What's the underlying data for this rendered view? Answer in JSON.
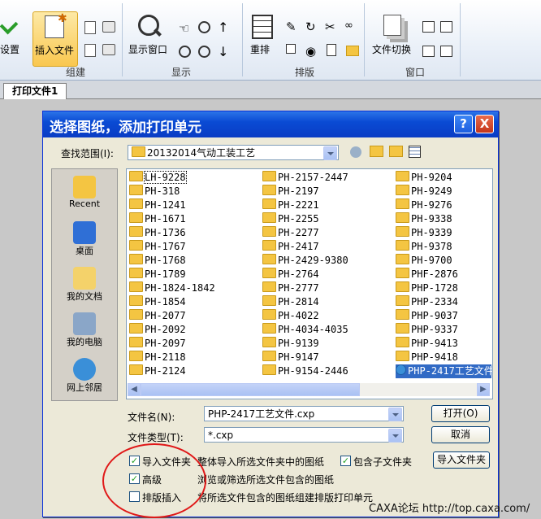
{
  "ribbon": {
    "settings_partial": "设置",
    "insert_file": "插入文件",
    "display_window": "显示窗口",
    "rearrange": "重排",
    "file_switch": "文件切换",
    "groups": [
      "组建",
      "显示",
      "排版",
      "窗口"
    ]
  },
  "doc_tab": "打印文件1",
  "dialog": {
    "title": "选择图纸，添加打印单元",
    "help": "?",
    "close": "X",
    "lookin_label": "查找范围(I):",
    "lookin_value": "20132014气动工装工艺",
    "places": [
      "Recent",
      "桌面",
      "我的文档",
      "我的电脑",
      "网上邻居"
    ],
    "columns": [
      [
        "LH-9228",
        "PH-318",
        "PH-1241",
        "PH-1671",
        "PH-1736",
        "PH-1767",
        "PH-1768",
        "PH-1789",
        "PH-1824-1842",
        "PH-1854",
        "PH-2077",
        "PH-2092",
        "PH-2097",
        "PH-2118",
        "PH-2124"
      ],
      [
        "PH-2157-2447",
        "PH-2197",
        "PH-2221",
        "PH-2255",
        "PH-2277",
        "PH-2417",
        "PH-2429-9380",
        "PH-2764",
        "PH-2777",
        "PH-2814",
        "PH-4022",
        "PH-4034-4035",
        "PH-9139",
        "PH-9147",
        "PH-9154-2446"
      ],
      [
        "PH-9204",
        "PH-9249",
        "PH-9276",
        "PH-9338",
        "PH-9339",
        "PH-9378",
        "PH-9700",
        "PHF-2876",
        "PHP-1728",
        "PHP-2334",
        "PHP-9037",
        "PHP-9337",
        "PHP-9413",
        "PHP-9418",
        "PHP-2417工艺文件"
      ]
    ],
    "filename_label": "文件名(N):",
    "filename_value": "PHP-2417工艺文件.cxp",
    "filetype_label": "文件类型(T):",
    "filetype_value": "*.cxp",
    "open_button": "打开(O)",
    "cancel_button": "取消",
    "import_folder_button": "导入文件夹",
    "opt_import_folder": "导入文件夹",
    "opt_import_desc": "整体导入所选文件夹中的图纸",
    "opt_subfolder": "包含子文件夹",
    "opt_advanced": "高级",
    "opt_advanced_desc": "浏览或筛选所选文件包含的图纸",
    "opt_layout_insert": "排版插入",
    "opt_layout_desc": "将所选文件包含的图纸组建排版打印单元",
    "checks": {
      "import_folder": true,
      "subfolder": true,
      "advanced": true,
      "layout": false
    }
  },
  "watermark": "CAXA论坛 http://top.caxa.com/",
  "colors": {
    "accent": "#0a4bd4",
    "annotation": "#e01818",
    "folder": "#f4c542"
  }
}
